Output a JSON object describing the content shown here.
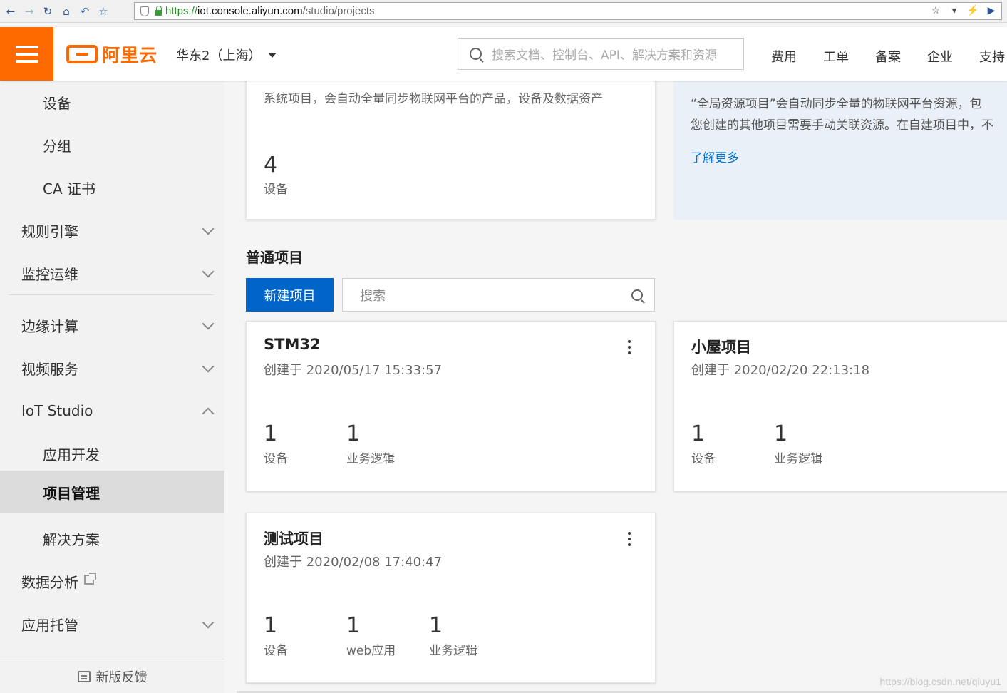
{
  "browser": {
    "url_proto": "https://",
    "url_host": "iot.console.aliyun.com",
    "url_path": "/studio/projects"
  },
  "header": {
    "logo_text": "阿里云",
    "region": "华东2（上海）",
    "search_placeholder": "搜索文档、控制台、API、解决方案和资源",
    "links": [
      "费用",
      "工单",
      "备案",
      "企业",
      "支持"
    ]
  },
  "sidebar": {
    "items": [
      {
        "label": "设备",
        "level": "sub"
      },
      {
        "label": "分组",
        "level": "sub"
      },
      {
        "label": "CA 证书",
        "level": "sub"
      },
      {
        "label": "规则引擎",
        "level": "top",
        "chevron": "down"
      },
      {
        "label": "监控运维",
        "level": "top",
        "chevron": "down"
      },
      {
        "label": "边缘计算",
        "level": "top",
        "chevron": "down"
      },
      {
        "label": "视频服务",
        "level": "top",
        "chevron": "down"
      },
      {
        "label": "IoT Studio",
        "level": "top",
        "chevron": "up"
      },
      {
        "label": "应用开发",
        "level": "sub"
      },
      {
        "label": "项目管理",
        "level": "sub",
        "active": true
      },
      {
        "label": "解决方案",
        "level": "sub"
      },
      {
        "label": "数据分析",
        "level": "top",
        "external": true
      },
      {
        "label": "应用托管",
        "level": "top",
        "chevron": "down"
      }
    ],
    "feedback": "新版反馈"
  },
  "global_project": {
    "desc": "系统项目，会自动全量同步物联网平台的产品，设备及数据资产",
    "device_count": "4",
    "device_label": "设备"
  },
  "info_box": {
    "line1": "“全局资源项目”会自动同步全量的物联网平台资源，包",
    "line2": "您创建的其他项目需要手动关联资源。在自建项目中，不",
    "link": "了解更多"
  },
  "normal_projects": {
    "title": "普通项目",
    "new_button": "新建项目",
    "search_placeholder": "搜索",
    "cards": [
      {
        "name": "STM32",
        "created": "创建于 2020/05/17 15:33:57",
        "stats": [
          {
            "num": "1",
            "label": "设备"
          },
          {
            "num": "1",
            "label": "业务逻辑"
          }
        ]
      },
      {
        "name": "小屋项目",
        "created": "创建于 2020/02/20 22:13:18",
        "stats": [
          {
            "num": "1",
            "label": "设备"
          },
          {
            "num": "1",
            "label": "业务逻辑"
          }
        ]
      },
      {
        "name": "测试项目",
        "created": "创建于 2020/02/08 17:40:47",
        "stats": [
          {
            "num": "1",
            "label": "设备"
          },
          {
            "num": "1",
            "label": "web应用"
          },
          {
            "num": "1",
            "label": "业务逻辑"
          }
        ]
      }
    ]
  },
  "watermark": "https://blog.csdn.net/qiuyu1"
}
